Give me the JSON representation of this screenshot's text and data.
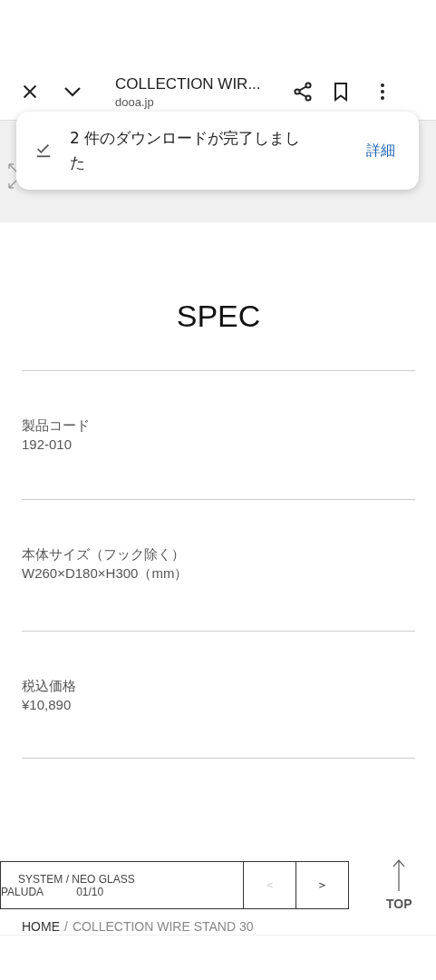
{
  "toolbar": {
    "title": "COLLECTION WIR...",
    "domain": "dooa.jp"
  },
  "toast": {
    "message": "2 件のダウンロードが完了しました",
    "action": "詳細"
  },
  "spec": {
    "heading": "SPEC",
    "items": [
      {
        "label": "製品コード",
        "value": "192-010"
      },
      {
        "label": "本体サイズ（フック除く）",
        "value": "W260×D180×H300（mm）"
      },
      {
        "label": "税込価格",
        "value": "¥10,890"
      }
    ]
  },
  "pager": {
    "category": "SYSTEM / NEO GLASS",
    "name": "PALUDA",
    "count": "01/10",
    "buttons": [
      {
        "label": "<",
        "disabled": true
      },
      {
        "label": ">",
        "disabled": false
      }
    ]
  },
  "top_link": "TOP",
  "breadcrumb": {
    "separator": "/",
    "items": [
      {
        "label": "HOME",
        "current": false
      },
      {
        "label": "COLLECTION WIRE STAND 30",
        "current": true
      }
    ]
  }
}
